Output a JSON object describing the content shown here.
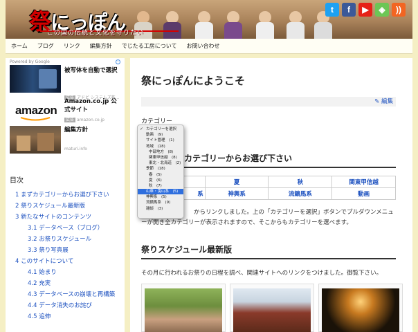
{
  "header": {
    "logo_char": "祭",
    "logo_rest": "にっぽん",
    "subtitle": "この国の伝統と文化を守りたい",
    "social": [
      {
        "icon": "twitter-icon",
        "glyph": "t",
        "color": "#1da1f2"
      },
      {
        "icon": "facebook-icon",
        "glyph": "f",
        "color": "#3b5998"
      },
      {
        "icon": "youtube-icon",
        "glyph": "▶",
        "color": "#e62117"
      },
      {
        "icon": "feedly-icon",
        "glyph": "◈",
        "color": "#6cc655"
      },
      {
        "icon": "rss-icon",
        "glyph": "))",
        "color": "#f26522"
      }
    ]
  },
  "nav": [
    "ホーム",
    "ブログ",
    "リンク",
    "編集方針",
    "でじたる工房について",
    "お問い合わせ"
  ],
  "sidebar": {
    "powered": "Powered by Google",
    "ads": [
      {
        "title": "被写体を自動で選択",
        "badge": "広告",
        "sub": "アドビ システムズ株..."
      },
      {
        "title": "Amazon.co.jp 公式サイト",
        "badge": "広告",
        "sub": "amazon.co.jp"
      },
      {
        "title": "編集方針",
        "badge": "",
        "sub": "maturi.info"
      }
    ],
    "amazon_logo": "amazon",
    "toc_title": "目次",
    "toc": [
      {
        "text": "1 まずカテゴリーからお選び下さい",
        "level": 1
      },
      {
        "text": "2 祭りスケジュール最新版",
        "level": 1
      },
      {
        "text": "3 新たなサイトのコンテンツ",
        "level": 1
      },
      {
        "text": "3.1 データベース（ブログ）",
        "level": 2
      },
      {
        "text": "3.2 お祭りスケジュール",
        "level": 2
      },
      {
        "text": "3.3 祭り写真展",
        "level": 2
      },
      {
        "text": "4 このサイトについて",
        "level": 1
      },
      {
        "text": "4.1 始まり",
        "level": 2
      },
      {
        "text": "4.2 充実",
        "level": 2
      },
      {
        "text": "4.3 データベースの崩壊と再構築",
        "level": 2
      },
      {
        "text": "4.4 データ消失のお詫び",
        "level": 2
      },
      {
        "text": "4.5 追伸",
        "level": 2
      }
    ]
  },
  "main": {
    "title": "祭にっぽんにようこそ",
    "edit": "編集",
    "category_label": "カテゴリー",
    "section1_title": "カテゴリーからお選び下さい",
    "grid": [
      [
        "",
        "夏",
        "秋",
        "関東甲信越"
      ],
      [
        "系",
        "神輿系",
        "流鏑馬系",
        "動画"
      ]
    ],
    "para1": "からリンクしました。上の「カテゴリーを選択」ボタンでプルダウンメニューが開き全カテゴリーが表示されますので、そこからもカテゴリーを選べます。",
    "section2_title": "祭りスケジュール最新版",
    "para2": "その月に行われるお祭りの日程を調べ、関連サイトへのリンクをつけました。御覧下さい。"
  },
  "dropdown": {
    "items": [
      {
        "label": "カテゴリーを選択",
        "indent": 0,
        "checked": true,
        "selected": false
      },
      {
        "label": "動画　(9)",
        "indent": 1,
        "checked": false,
        "selected": false
      },
      {
        "label": "サイト管理　(1)",
        "indent": 1,
        "checked": false,
        "selected": false
      },
      {
        "label": "地域　(18)",
        "indent": 1,
        "checked": false,
        "selected": false
      },
      {
        "label": "中部地方　(8)",
        "indent": 2,
        "checked": false,
        "selected": false
      },
      {
        "label": "関東甲信越　(8)",
        "indent": 2,
        "checked": false,
        "selected": false
      },
      {
        "label": "東北・北海道　(2)",
        "indent": 2,
        "checked": false,
        "selected": false
      },
      {
        "label": "季節　(18)",
        "indent": 1,
        "checked": false,
        "selected": false
      },
      {
        "label": "春　(5)",
        "indent": 2,
        "checked": false,
        "selected": false
      },
      {
        "label": "夏　(6)",
        "indent": 2,
        "checked": false,
        "selected": false
      },
      {
        "label": "秋　(7)",
        "indent": 2,
        "checked": false,
        "selected": false
      },
      {
        "label": "山車・曳山系　(5)",
        "indent": 1,
        "checked": false,
        "selected": true
      },
      {
        "label": "神輿系　(5)",
        "indent": 1,
        "checked": false,
        "selected": false
      },
      {
        "label": "流鏑馬系　(9)",
        "indent": 1,
        "checked": false,
        "selected": false
      },
      {
        "label": "雑談　(3)",
        "indent": 1,
        "checked": false,
        "selected": false
      }
    ]
  }
}
